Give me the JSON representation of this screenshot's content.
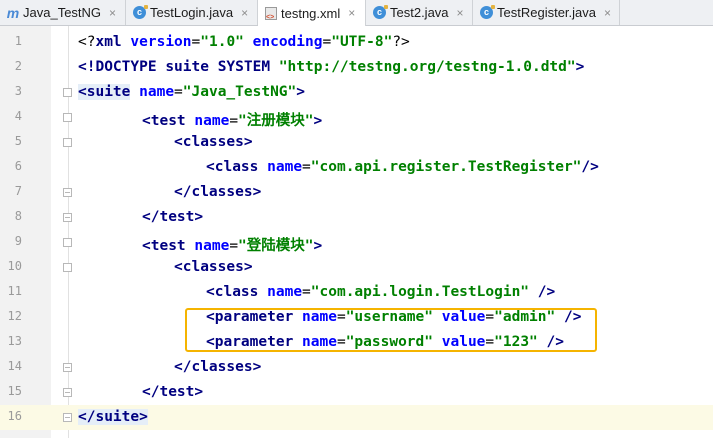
{
  "tabs": [
    {
      "label": "Java_TestNG",
      "icon": "module-icon",
      "close": "×"
    },
    {
      "label": "TestLogin.java",
      "icon": "java-class-icon",
      "close": "×"
    },
    {
      "label": "testng.xml",
      "icon": "xml-file-icon",
      "close": "×",
      "active": true
    },
    {
      "label": "Test2.java",
      "icon": "java-class-icon",
      "close": "×"
    },
    {
      "label": "TestRegister.java",
      "icon": "java-class-icon",
      "close": "×"
    }
  ],
  "icon_letters": {
    "module": "m",
    "class": "c"
  },
  "lines": [
    {
      "no": "1",
      "open": "<?",
      "tag": "xml",
      "a1": "version",
      "eq1": "=",
      "v1": "\"1.0\"",
      "a2": "encoding",
      "eq2": "=",
      "v2": "\"UTF-8\"",
      "close": "?>"
    },
    {
      "no": "2",
      "open": "<!",
      "tag": "DOCTYPE",
      "rest": "suite SYSTEM",
      "v1": "\"http://testng.org/testng-1.0.dtd\"",
      "close": ">"
    },
    {
      "no": "3",
      "open": "<",
      "tag": "suite",
      "a1": "name",
      "eq1": "=",
      "v1": "\"Java_TestNG\"",
      "close": ">"
    },
    {
      "no": "4",
      "open": "<",
      "tag": "test",
      "a1": "name",
      "eq1": "=",
      "v1": "\"注册模块\"",
      "close": ">"
    },
    {
      "no": "5",
      "open": "<",
      "tag": "classes",
      "close": ">"
    },
    {
      "no": "6",
      "open": "<",
      "tag": "class",
      "a1": "name",
      "eq1": "=",
      "v1": "\"com.api.register.TestRegister\"",
      "close": "/>"
    },
    {
      "no": "7",
      "open": "</",
      "tag": "classes",
      "close": ">"
    },
    {
      "no": "8",
      "open": "</",
      "tag": "test",
      "close": ">"
    },
    {
      "no": "9",
      "open": "<",
      "tag": "test",
      "a1": "name",
      "eq1": "=",
      "v1": "\"登陆模块\"",
      "close": ">"
    },
    {
      "no": "10",
      "open": "<",
      "tag": "classes",
      "close": ">"
    },
    {
      "no": "11",
      "open": "<",
      "tag": "class",
      "a1": "name",
      "eq1": "=",
      "v1": "\"com.api.login.TestLogin\"",
      "close": " />"
    },
    {
      "no": "12",
      "open": "<",
      "tag": "parameter",
      "a1": "name",
      "eq1": "=",
      "v1": "\"username\"",
      "a2": "value",
      "eq2": "=",
      "v2": "\"admin\"",
      "close": " />"
    },
    {
      "no": "13",
      "open": "<",
      "tag": "parameter",
      "a1": "name",
      "eq1": "=",
      "v1": "\"password\"",
      "a2": "value",
      "eq2": "=",
      "v2": "\"123\"",
      "close": " />"
    },
    {
      "no": "14",
      "open": "</",
      "tag": "classes",
      "close": ">"
    },
    {
      "no": "15",
      "open": "</",
      "tag": "test",
      "close": ">"
    },
    {
      "no": "16",
      "open": "</",
      "tag": "suite",
      "close": ">"
    }
  ],
  "colors": {
    "tag": "#000080",
    "attribute": "#0000ff",
    "value": "#008000",
    "highlight_box": "#f5b400",
    "current_line": "#fcfae5"
  }
}
